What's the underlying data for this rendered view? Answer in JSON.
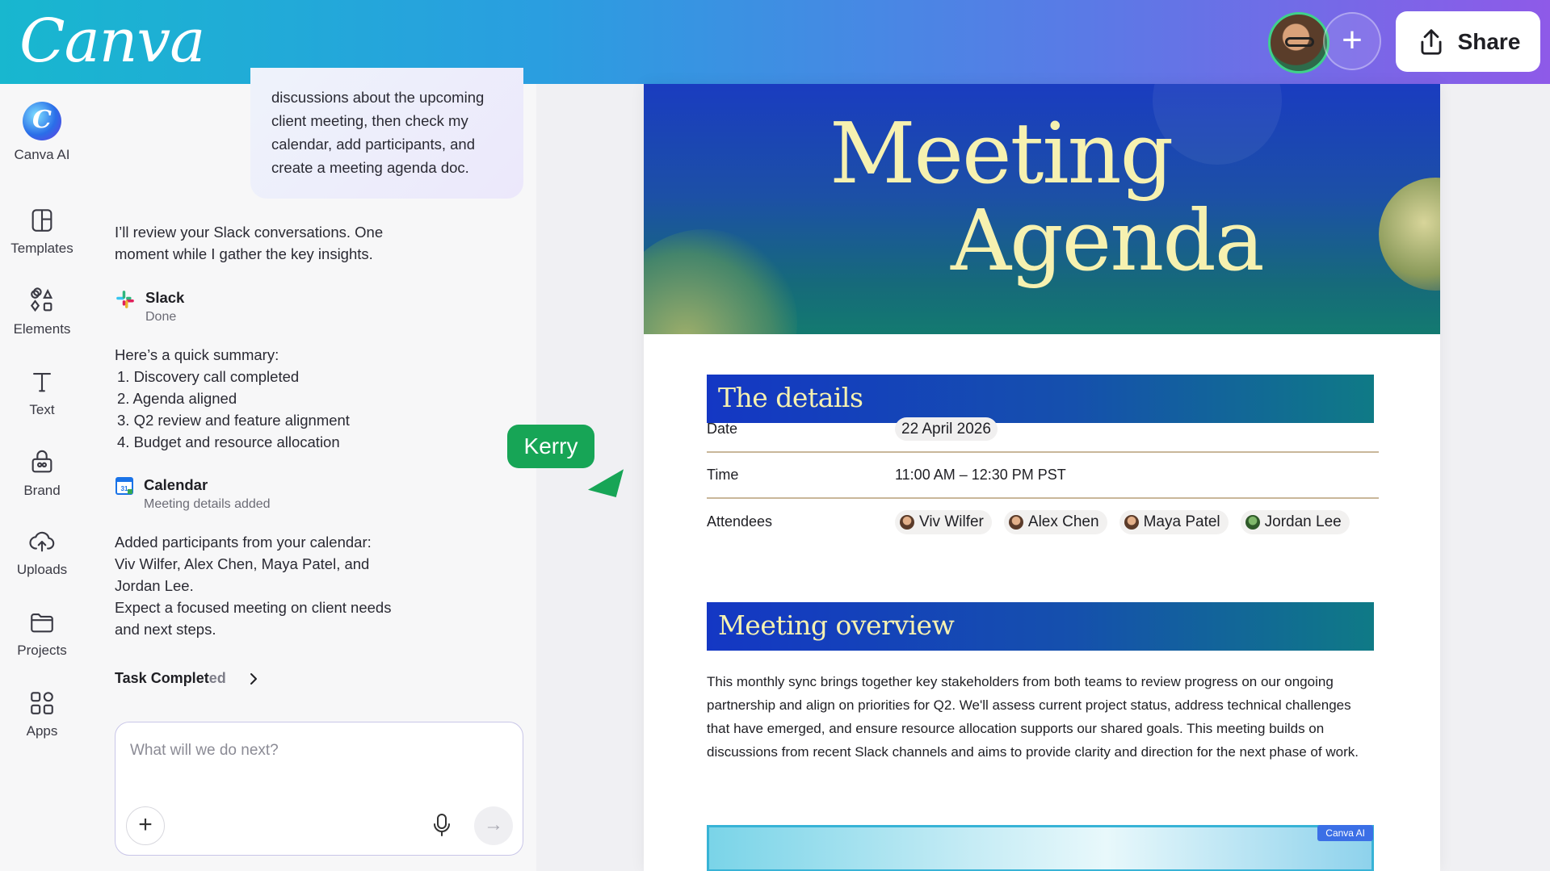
{
  "header": {
    "logo_text": "Canva",
    "share_label": "Share",
    "add_label": "+"
  },
  "rail": {
    "items": [
      {
        "label": "Canva AI",
        "icon": "canva-ai-icon"
      },
      {
        "label": "Templates",
        "icon": "templates-icon"
      },
      {
        "label": "Elements",
        "icon": "elements-icon"
      },
      {
        "label": "Text",
        "icon": "text-icon"
      },
      {
        "label": "Brand",
        "icon": "brand-icon"
      },
      {
        "label": "Uploads",
        "icon": "uploads-icon"
      },
      {
        "label": "Projects",
        "icon": "projects-icon"
      },
      {
        "label": "Apps",
        "icon": "apps-icon"
      }
    ]
  },
  "chat": {
    "user_message_lines": [
      "discussions about the upcoming",
      "client meeting, then check my",
      "calendar, add participants, and",
      "create a meeting agenda doc."
    ],
    "reply_1_lines": [
      "I’ll review your Slack conversations. One",
      "moment while I gather the key insights."
    ],
    "tool_slack": {
      "name": "Slack",
      "status": "Done"
    },
    "summary_intro": "Here’s a quick summary:",
    "summary_items": [
      "1. Discovery call completed",
      "2. Agenda aligned",
      "3. Q2 review and feature alignment",
      "4. Budget and resource allocation"
    ],
    "tool_calendar": {
      "name": "Calendar",
      "status": "Meeting details added"
    },
    "reply_2_lines": [
      "Added participants from your calendar:",
      "Viv Wilfer, Alex Chen, Maya Patel, and",
      "Jordan Lee.",
      "Expect a focused meeting on client needs",
      "and next steps."
    ],
    "task_completed_a": "Task Complet",
    "task_completed_b": "ed",
    "composer_placeholder": "What will we do next?"
  },
  "collaborator_cursor": {
    "name": "Kerry",
    "color": "#17a556"
  },
  "document": {
    "title_line_1": "Meeting",
    "title_line_2": "Agenda",
    "details_heading": "The details",
    "rows": [
      {
        "key": "Date",
        "value": "22 April 2026"
      },
      {
        "key": "Time",
        "value": "11:00 AM – 12:30 PM PST"
      },
      {
        "key": "Attendees",
        "value": ""
      }
    ],
    "attendees": [
      "Viv Wilfer",
      "Alex Chen",
      "Maya Patel",
      "Jordan Lee"
    ],
    "overview_heading": "Meeting overview",
    "overview_text": "This monthly sync brings together key stakeholders from both teams to review progress on our ongoing partnership and align on priorities for Q2. We'll assess current project status, address technical challenges that have emerged, and ensure resource allocation supports our shared goals. This meeting builds on discussions from recent Slack channels and aims to provide clarity and direction for the next phase of work.",
    "ai_tag": "Canva AI"
  },
  "colors": {
    "header_gradient_start": "#18b7cf",
    "header_gradient_end": "#8e5ae8",
    "doc_title": "#f6f1b0",
    "section_bar": "#1437c4",
    "collaborator": "#17a556"
  }
}
